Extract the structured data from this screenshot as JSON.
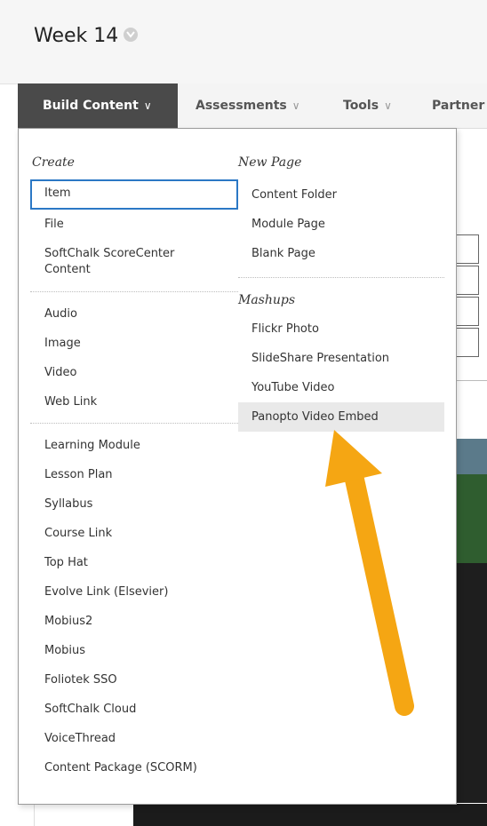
{
  "page": {
    "title": "Week 14"
  },
  "toolbar": {
    "build_content": "Build Content",
    "assessments": "Assessments",
    "tools": "Tools",
    "partner": "Partner"
  },
  "menu": {
    "create_heading": "Create",
    "create_items": [
      "Item",
      "File",
      "SoftChalk ScoreCenter",
      "Content"
    ],
    "media_items": [
      "Audio",
      "Image",
      "Video",
      "Web Link"
    ],
    "tool_items": [
      "Learning Module",
      "Lesson Plan",
      "Syllabus",
      "Course Link",
      "Top Hat",
      "Evolve Link (Elsevier)",
      "Mobius2",
      "Mobius",
      "Foliotek SSO",
      "SoftChalk Cloud",
      "VoiceThread",
      "Content Package (SCORM)"
    ],
    "new_page_heading": "New Page",
    "new_page_items": [
      "Content Folder",
      "Module Page",
      "Blank Page"
    ],
    "mashups_heading": "Mashups",
    "mashup_items": [
      "Flickr Photo",
      "SlideShare Presentation",
      "YouTube Video",
      "Panopto Video Embed"
    ]
  },
  "colors": {
    "accent_arrow": "#f5a613",
    "focus_border": "#2b78c5",
    "toolbar_active": "#4a4a4a"
  }
}
